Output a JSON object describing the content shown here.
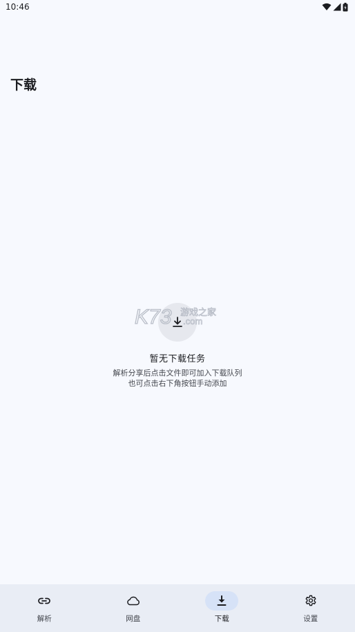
{
  "status_bar": {
    "time": "10:46",
    "icons": [
      "wifi-icon",
      "signal-icon",
      "battery-icon"
    ]
  },
  "page": {
    "title": "下载"
  },
  "empty_state": {
    "icon": "download-icon",
    "watermark": "K73 游戏之家 .com",
    "title": "暂无下载任务",
    "hint_line1": "解析分享后点击文件即可加入下载队列",
    "hint_line2": "也可点击右下角按钮手动添加"
  },
  "bottom_nav": {
    "items": [
      {
        "label": "解析",
        "icon": "link-icon",
        "active": false
      },
      {
        "label": "网盘",
        "icon": "cloud-icon",
        "active": false
      },
      {
        "label": "下载",
        "icon": "download-icon",
        "active": true
      },
      {
        "label": "设置",
        "icon": "gear-icon",
        "active": false
      }
    ]
  },
  "colors": {
    "background": "#f7f9fe",
    "nav_background": "#e9edf5",
    "active_pill": "#d6e2f7",
    "text_primary": "#1b1c20",
    "text_secondary": "#44474e"
  }
}
